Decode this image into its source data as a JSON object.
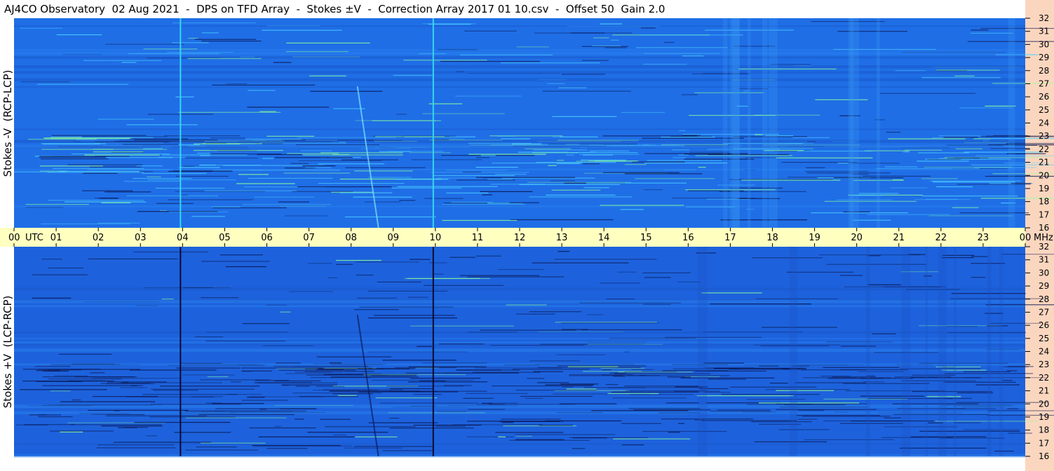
{
  "title": "AJ4CO Observatory  02 Aug 2021  -  DPS on TFD Array  -  Stokes ±V  -  Correction Array 2017 01 10.csv  -  Offset 50  Gain 2.0",
  "chart_data": [
    {
      "type": "heatmap",
      "panel": "top",
      "ylabel": "Stokes -V  (RCP-LCP)",
      "y_unit": "MHz",
      "ylim": [
        16,
        32
      ],
      "y_ticks": [
        "16",
        "17",
        "18",
        "19",
        "20",
        "21",
        "22",
        "23",
        "24",
        "25",
        "26",
        "27",
        "28",
        "29",
        "30",
        "31",
        "32"
      ],
      "base_color": "#1f6ee6",
      "vertical_lines_utc": [
        3.95,
        9.95
      ],
      "vertical_line_color": "#35d7f2"
    },
    {
      "type": "heatmap",
      "panel": "bottom",
      "ylabel": "Stokes +V  (LCP-RCP)",
      "y_unit": "MHz",
      "ylim": [
        16,
        32
      ],
      "y_ticks": [
        "16",
        "17",
        "18",
        "19",
        "20",
        "21",
        "22",
        "23",
        "24",
        "25",
        "26",
        "27",
        "28",
        "29",
        "30",
        "31",
        "32"
      ],
      "base_color": "#1d62dc",
      "vertical_lines_utc": [
        3.95,
        9.95
      ],
      "vertical_line_color": "#050a30"
    }
  ],
  "time_axis": {
    "xlim": [
      0,
      24
    ],
    "labels": [
      "00",
      "01",
      "02",
      "03",
      "04",
      "05",
      "06",
      "07",
      "08",
      "09",
      "10",
      "11",
      "12",
      "13",
      "14",
      "15",
      "16",
      "17",
      "18",
      "19",
      "20",
      "21",
      "22",
      "23",
      "00"
    ],
    "utc_label": "UTC",
    "mhz_label": "MHz",
    "band_color": "#ffffc0"
  },
  "colors": {
    "right_strip": "#fbd6bf",
    "noise_bright": "#4dd2ff",
    "noise_green": "#8cff9a",
    "noise_dark": "#0a1550"
  }
}
